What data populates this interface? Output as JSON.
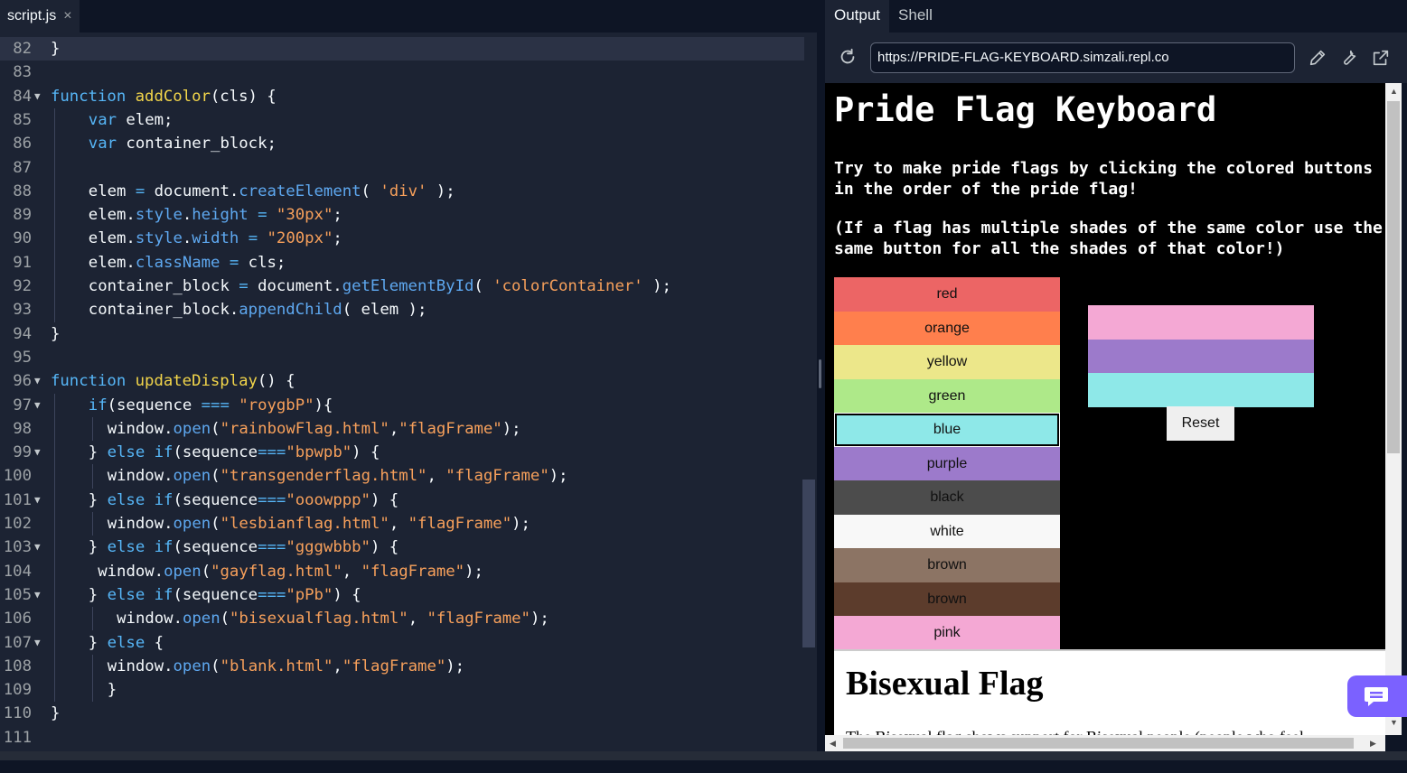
{
  "editor": {
    "file_tab": "script.js",
    "close_glyph": "×",
    "lines": [
      {
        "n": "82",
        "fold": "",
        "indent": 0,
        "tokens": [
          [
            "}",
            ""
          ]
        ],
        "active": true
      },
      {
        "n": "83",
        "fold": "",
        "indent": 0,
        "tokens": []
      },
      {
        "n": "84",
        "fold": "▼",
        "indent": 0,
        "tokens": [
          [
            "function",
            "kw"
          ],
          [
            " ",
            ""
          ],
          [
            "addColor",
            "fn"
          ],
          [
            "(cls) {",
            ""
          ]
        ]
      },
      {
        "n": "85",
        "fold": "",
        "indent": 4,
        "tokens": [
          [
            "var",
            "kw"
          ],
          [
            " elem;",
            ""
          ]
        ]
      },
      {
        "n": "86",
        "fold": "",
        "indent": 4,
        "tokens": [
          [
            "var",
            "kw"
          ],
          [
            " container_block;",
            ""
          ]
        ]
      },
      {
        "n": "87",
        "fold": "",
        "indent": 0,
        "tokens": []
      },
      {
        "n": "88",
        "fold": "",
        "indent": 4,
        "tokens": [
          [
            "elem ",
            ""
          ],
          [
            "=",
            "op"
          ],
          [
            " document.",
            ""
          ],
          [
            "createElement",
            "prop"
          ],
          [
            "( ",
            ""
          ],
          [
            "'div'",
            "str"
          ],
          [
            " );",
            ""
          ]
        ]
      },
      {
        "n": "89",
        "fold": "",
        "indent": 4,
        "tokens": [
          [
            "elem.",
            ""
          ],
          [
            "style",
            "prop"
          ],
          [
            ".",
            ""
          ],
          [
            "height",
            "prop"
          ],
          [
            " ",
            ""
          ],
          [
            "=",
            "op"
          ],
          [
            " ",
            ""
          ],
          [
            "\"30px\"",
            "str"
          ],
          [
            ";",
            ""
          ]
        ]
      },
      {
        "n": "90",
        "fold": "",
        "indent": 4,
        "tokens": [
          [
            "elem.",
            ""
          ],
          [
            "style",
            "prop"
          ],
          [
            ".",
            ""
          ],
          [
            "width",
            "prop"
          ],
          [
            " ",
            ""
          ],
          [
            "=",
            "op"
          ],
          [
            " ",
            ""
          ],
          [
            "\"200px\"",
            "str"
          ],
          [
            ";",
            ""
          ]
        ]
      },
      {
        "n": "91",
        "fold": "",
        "indent": 4,
        "tokens": [
          [
            "elem.",
            ""
          ],
          [
            "className",
            "prop"
          ],
          [
            " ",
            ""
          ],
          [
            "=",
            "op"
          ],
          [
            " cls;",
            ""
          ]
        ]
      },
      {
        "n": "92",
        "fold": "",
        "indent": 4,
        "tokens": [
          [
            "container_block ",
            ""
          ],
          [
            "=",
            "op"
          ],
          [
            " document.",
            ""
          ],
          [
            "getElementById",
            "prop"
          ],
          [
            "( ",
            ""
          ],
          [
            "'colorContainer'",
            "str"
          ],
          [
            " );",
            ""
          ]
        ]
      },
      {
        "n": "93",
        "fold": "",
        "indent": 4,
        "tokens": [
          [
            "container_block.",
            ""
          ],
          [
            "appendChild",
            "prop"
          ],
          [
            "( elem );",
            ""
          ]
        ]
      },
      {
        "n": "94",
        "fold": "",
        "indent": 0,
        "tokens": [
          [
            "}",
            ""
          ]
        ]
      },
      {
        "n": "95",
        "fold": "",
        "indent": 0,
        "tokens": []
      },
      {
        "n": "96",
        "fold": "▼",
        "indent": 0,
        "tokens": [
          [
            "function",
            "kw"
          ],
          [
            " ",
            ""
          ],
          [
            "updateDisplay",
            "fn"
          ],
          [
            "() {",
            ""
          ]
        ]
      },
      {
        "n": "97",
        "fold": "▼",
        "indent": 4,
        "tokens": [
          [
            "if",
            "kw"
          ],
          [
            "(sequence ",
            ""
          ],
          [
            "===",
            "op"
          ],
          [
            " ",
            ""
          ],
          [
            "\"roygbP\"",
            "str"
          ],
          [
            "){",
            ""
          ]
        ]
      },
      {
        "n": "98",
        "fold": "",
        "indent": 6,
        "tokens": [
          [
            "window.",
            ""
          ],
          [
            "open",
            "prop"
          ],
          [
            "(",
            ""
          ],
          [
            "\"rainbowFlag.html\"",
            "str"
          ],
          [
            ",",
            ""
          ],
          [
            "\"flagFrame\"",
            "str"
          ],
          [
            ");",
            ""
          ]
        ]
      },
      {
        "n": "99",
        "fold": "▼",
        "indent": 4,
        "tokens": [
          [
            "} ",
            ""
          ],
          [
            "else",
            "kw"
          ],
          [
            " ",
            ""
          ],
          [
            "if",
            "kw"
          ],
          [
            "(sequence",
            ""
          ],
          [
            "===",
            "op"
          ],
          [
            "\"bpwpb\"",
            "str"
          ],
          [
            ") {",
            ""
          ]
        ]
      },
      {
        "n": "100",
        "fold": "",
        "indent": 6,
        "tokens": [
          [
            "window.",
            ""
          ],
          [
            "open",
            "prop"
          ],
          [
            "(",
            ""
          ],
          [
            "\"transgenderflag.html\"",
            "str"
          ],
          [
            ", ",
            ""
          ],
          [
            "\"flagFrame\"",
            "str"
          ],
          [
            ");",
            ""
          ]
        ]
      },
      {
        "n": "101",
        "fold": "▼",
        "indent": 4,
        "tokens": [
          [
            "} ",
            ""
          ],
          [
            "else",
            "kw"
          ],
          [
            " ",
            ""
          ],
          [
            "if",
            "kw"
          ],
          [
            "(sequence",
            ""
          ],
          [
            "===",
            "op"
          ],
          [
            "\"ooowppp\"",
            "str"
          ],
          [
            ") {",
            ""
          ]
        ]
      },
      {
        "n": "102",
        "fold": "",
        "indent": 6,
        "tokens": [
          [
            "window.",
            ""
          ],
          [
            "open",
            "prop"
          ],
          [
            "(",
            ""
          ],
          [
            "\"lesbianflag.html\"",
            "str"
          ],
          [
            ", ",
            ""
          ],
          [
            "\"flagFrame\"",
            "str"
          ],
          [
            ");",
            ""
          ]
        ]
      },
      {
        "n": "103",
        "fold": "▼",
        "indent": 4,
        "tokens": [
          [
            "} ",
            ""
          ],
          [
            "else",
            "kw"
          ],
          [
            " ",
            ""
          ],
          [
            "if",
            "kw"
          ],
          [
            "(sequence",
            ""
          ],
          [
            "===",
            "op"
          ],
          [
            "\"gggwbbb\"",
            "str"
          ],
          [
            ") {",
            ""
          ]
        ]
      },
      {
        "n": "104",
        "fold": "",
        "indent": 5,
        "tokens": [
          [
            "window.",
            ""
          ],
          [
            "open",
            "prop"
          ],
          [
            "(",
            ""
          ],
          [
            "\"gayflag.html\"",
            "str"
          ],
          [
            ", ",
            ""
          ],
          [
            "\"flagFrame\"",
            "str"
          ],
          [
            ");",
            ""
          ]
        ]
      },
      {
        "n": "105",
        "fold": "▼",
        "indent": 4,
        "tokens": [
          [
            "} ",
            ""
          ],
          [
            "else",
            "kw"
          ],
          [
            " ",
            ""
          ],
          [
            "if",
            "kw"
          ],
          [
            "(sequence",
            ""
          ],
          [
            "===",
            "op"
          ],
          [
            "\"pPb\"",
            "str"
          ],
          [
            ") {",
            ""
          ]
        ]
      },
      {
        "n": "106",
        "fold": "",
        "indent": 7,
        "tokens": [
          [
            "window.",
            ""
          ],
          [
            "open",
            "prop"
          ],
          [
            "(",
            ""
          ],
          [
            "\"bisexualflag.html\"",
            "str"
          ],
          [
            ", ",
            ""
          ],
          [
            "\"flagFrame\"",
            "str"
          ],
          [
            ");",
            ""
          ]
        ]
      },
      {
        "n": "107",
        "fold": "▼",
        "indent": 4,
        "tokens": [
          [
            "} ",
            ""
          ],
          [
            "else",
            "kw"
          ],
          [
            " {",
            ""
          ]
        ]
      },
      {
        "n": "108",
        "fold": "",
        "indent": 6,
        "tokens": [
          [
            "window.",
            ""
          ],
          [
            "open",
            "prop"
          ],
          [
            "(",
            ""
          ],
          [
            "\"blank.html\"",
            "str"
          ],
          [
            ",",
            ""
          ],
          [
            "\"flagFrame\"",
            "str"
          ],
          [
            ");",
            ""
          ]
        ]
      },
      {
        "n": "109",
        "fold": "",
        "indent": 6,
        "tokens": [
          [
            "}",
            ""
          ]
        ]
      },
      {
        "n": "110",
        "fold": "",
        "indent": 0,
        "tokens": [
          [
            "}",
            ""
          ]
        ]
      },
      {
        "n": "111",
        "fold": "",
        "indent": 0,
        "tokens": []
      }
    ]
  },
  "right_panel": {
    "tabs": [
      {
        "label": "Output",
        "active": true
      },
      {
        "label": "Shell",
        "active": false
      }
    ],
    "url": "https://PRIDE-FLAG-KEYBOARD.simzali.repl.co",
    "icons": [
      "reload-icon",
      "pencil-icon",
      "wrench-icon",
      "open-external-icon",
      "chat-icon"
    ]
  },
  "page": {
    "title": "Pride Flag Keyboard",
    "instructions": "Try to make pride flags by clicking the colored buttons in the order of the pride flag!",
    "note": "(If a flag has multiple shades of the same color use the same button for all the shades of that color!)",
    "color_buttons": [
      {
        "label": "red",
        "color": "#ec6565"
      },
      {
        "label": "orange",
        "color": "#ff7f4d"
      },
      {
        "label": "yellow",
        "color": "#ece78a"
      },
      {
        "label": "green",
        "color": "#aee989"
      },
      {
        "label": "blue",
        "color": "#8ee8e8",
        "focused": true
      },
      {
        "label": "purple",
        "color": "#9c7acb"
      },
      {
        "label": "black",
        "color": "#4c4c4c"
      },
      {
        "label": "white",
        "color": "#f8f8f8"
      },
      {
        "label": "brown",
        "color": "#8c7464"
      },
      {
        "label": "brown",
        "color": "#5c3c2c"
      },
      {
        "label": "pink",
        "color": "#f4a8d4"
      }
    ],
    "flag_stripes": [
      "#f4a8d4",
      "#9c7acb",
      "#8ee8e8"
    ],
    "reset_label": "Reset",
    "frame_title": "Bisexual Flag",
    "frame_text": "The Bisexual flag shows support for Bisexual people (people who feel"
  }
}
